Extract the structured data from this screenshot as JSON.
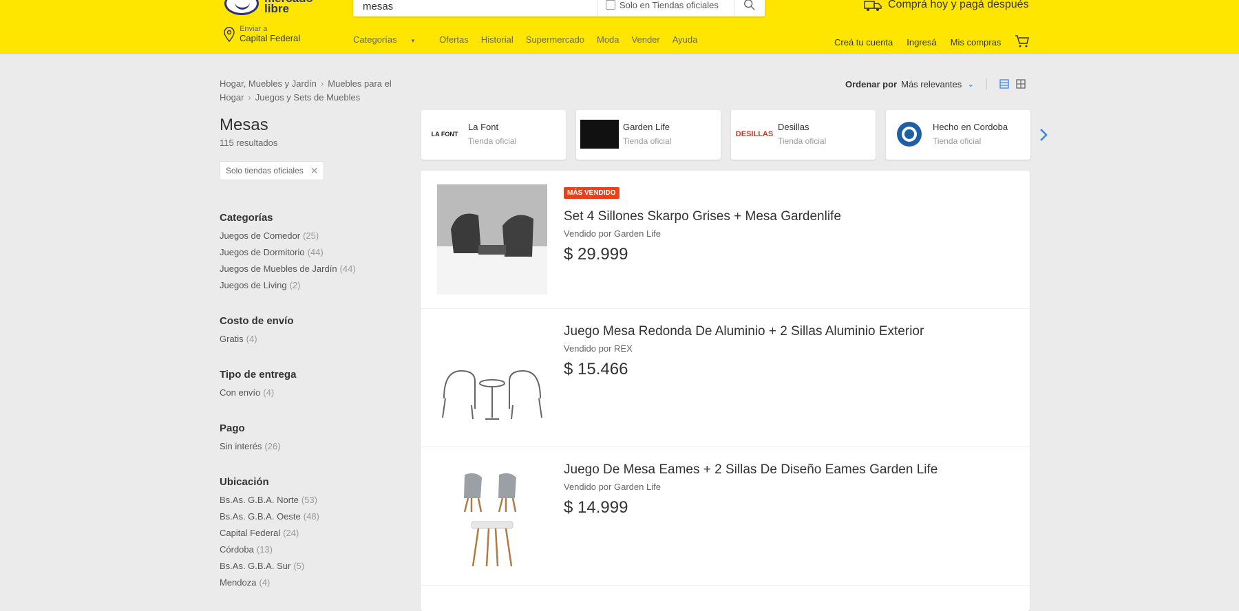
{
  "header": {
    "logo_text": "mercado libre",
    "search": {
      "value": "mesas",
      "official_label": "Solo en Tiendas oficiales"
    },
    "promo": "Comprá hoy y pagá después",
    "location": {
      "small": "Enviar a",
      "big": "Capital Federal"
    },
    "nav": [
      "Categorías",
      "Ofertas",
      "Historial",
      "Supermercado",
      "Moda",
      "Vender",
      "Ayuda"
    ],
    "right_nav": [
      "Creá tu cuenta",
      "Ingresá",
      "Mis compras"
    ]
  },
  "breadcrumb": [
    "Hogar, Muebles y Jardín",
    "Muebles para el Hogar",
    "Juegos y Sets de Muebles"
  ],
  "sort": {
    "label": "Ordenar por",
    "value": "Más relevantes"
  },
  "sidebar": {
    "title": "Mesas",
    "count": "115 resultados",
    "filter_tag": "Solo tiendas oficiales",
    "groups": [
      {
        "title": "Categorías",
        "options": [
          {
            "label": "Juegos de Comedor",
            "count": "(25)"
          },
          {
            "label": "Juegos de Dormitorio",
            "count": "(44)"
          },
          {
            "label": "Juegos de Muebles de Jardín",
            "count": "(44)"
          },
          {
            "label": "Juegos de Living",
            "count": "(2)"
          }
        ]
      },
      {
        "title": "Costo de envío",
        "options": [
          {
            "label": "Gratis",
            "count": "(4)"
          }
        ]
      },
      {
        "title": "Tipo de entrega",
        "options": [
          {
            "label": "Con envío",
            "count": "(4)"
          }
        ]
      },
      {
        "title": "Pago",
        "options": [
          {
            "label": "Sin interés",
            "count": "(26)"
          }
        ]
      },
      {
        "title": "Ubicación",
        "options": [
          {
            "label": "Bs.As. G.B.A. Norte",
            "count": "(53)"
          },
          {
            "label": "Bs.As. G.B.A. Oeste",
            "count": "(48)"
          },
          {
            "label": "Capital Federal",
            "count": "(24)"
          },
          {
            "label": "Córdoba",
            "count": "(13)"
          },
          {
            "label": "Bs.As. G.B.A. Sur",
            "count": "(5)"
          },
          {
            "label": "Mendoza",
            "count": "(4)"
          }
        ]
      }
    ]
  },
  "stores": [
    {
      "name": "La Font",
      "sub": "Tienda oficial",
      "logo": "LA FONT"
    },
    {
      "name": "Garden Life",
      "sub": "Tienda oficial",
      "logo": ""
    },
    {
      "name": "Desillas",
      "sub": "Tienda oficial",
      "logo": "DESILLAS"
    },
    {
      "name": "Hecho en Cordoba",
      "sub": "Tienda oficial",
      "logo": ""
    }
  ],
  "results": [
    {
      "badge": "MÁS VENDIDO",
      "title": "Set 4 Sillones Skarpo Grises + Mesa Gardenlife",
      "seller": "Vendido por Garden Life",
      "price": "$ 29.999"
    },
    {
      "badge": "",
      "title": "Juego Mesa Redonda De Aluminio + 2 Sillas Aluminio Exterior",
      "seller": "Vendido por REX",
      "price": "$ 15.466"
    },
    {
      "badge": "",
      "title": "Juego De Mesa Eames + 2 Sillas De Diseño Eames Garden Life",
      "seller": "Vendido por Garden Life",
      "price": "$ 14.999"
    }
  ],
  "colors": {
    "header_bg": "#ffe600",
    "brand_blue": "#2d3277",
    "link_blue": "#3483fa",
    "badge": "#e8421a"
  }
}
